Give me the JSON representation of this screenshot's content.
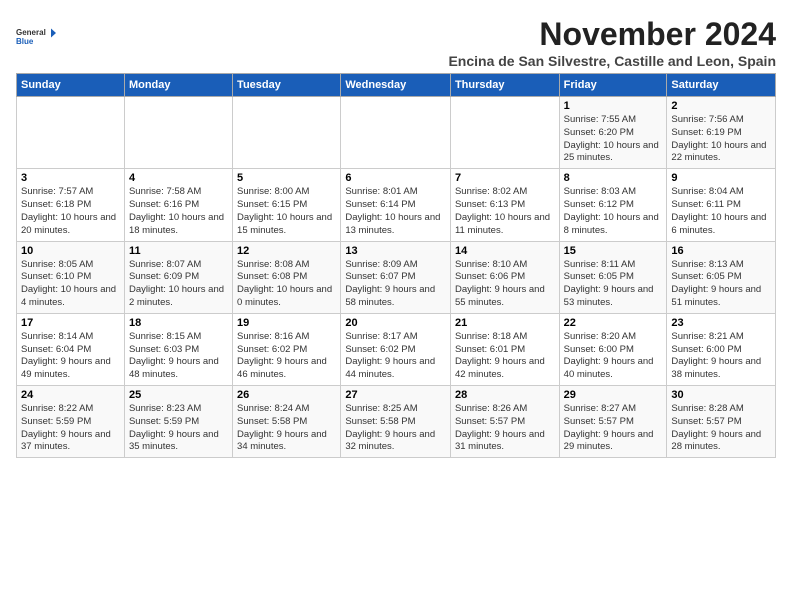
{
  "logo": {
    "line1": "General",
    "line2": "Blue"
  },
  "title": "November 2024",
  "subtitle": "Encina de San Silvestre, Castille and Leon, Spain",
  "days_of_week": [
    "Sunday",
    "Monday",
    "Tuesday",
    "Wednesday",
    "Thursday",
    "Friday",
    "Saturday"
  ],
  "weeks": [
    [
      {
        "day": "",
        "info": ""
      },
      {
        "day": "",
        "info": ""
      },
      {
        "day": "",
        "info": ""
      },
      {
        "day": "",
        "info": ""
      },
      {
        "day": "",
        "info": ""
      },
      {
        "day": "1",
        "info": "Sunrise: 7:55 AM\nSunset: 6:20 PM\nDaylight: 10 hours and 25 minutes."
      },
      {
        "day": "2",
        "info": "Sunrise: 7:56 AM\nSunset: 6:19 PM\nDaylight: 10 hours and 22 minutes."
      }
    ],
    [
      {
        "day": "3",
        "info": "Sunrise: 7:57 AM\nSunset: 6:18 PM\nDaylight: 10 hours and 20 minutes."
      },
      {
        "day": "4",
        "info": "Sunrise: 7:58 AM\nSunset: 6:16 PM\nDaylight: 10 hours and 18 minutes."
      },
      {
        "day": "5",
        "info": "Sunrise: 8:00 AM\nSunset: 6:15 PM\nDaylight: 10 hours and 15 minutes."
      },
      {
        "day": "6",
        "info": "Sunrise: 8:01 AM\nSunset: 6:14 PM\nDaylight: 10 hours and 13 minutes."
      },
      {
        "day": "7",
        "info": "Sunrise: 8:02 AM\nSunset: 6:13 PM\nDaylight: 10 hours and 11 minutes."
      },
      {
        "day": "8",
        "info": "Sunrise: 8:03 AM\nSunset: 6:12 PM\nDaylight: 10 hours and 8 minutes."
      },
      {
        "day": "9",
        "info": "Sunrise: 8:04 AM\nSunset: 6:11 PM\nDaylight: 10 hours and 6 minutes."
      }
    ],
    [
      {
        "day": "10",
        "info": "Sunrise: 8:05 AM\nSunset: 6:10 PM\nDaylight: 10 hours and 4 minutes."
      },
      {
        "day": "11",
        "info": "Sunrise: 8:07 AM\nSunset: 6:09 PM\nDaylight: 10 hours and 2 minutes."
      },
      {
        "day": "12",
        "info": "Sunrise: 8:08 AM\nSunset: 6:08 PM\nDaylight: 10 hours and 0 minutes."
      },
      {
        "day": "13",
        "info": "Sunrise: 8:09 AM\nSunset: 6:07 PM\nDaylight: 9 hours and 58 minutes."
      },
      {
        "day": "14",
        "info": "Sunrise: 8:10 AM\nSunset: 6:06 PM\nDaylight: 9 hours and 55 minutes."
      },
      {
        "day": "15",
        "info": "Sunrise: 8:11 AM\nSunset: 6:05 PM\nDaylight: 9 hours and 53 minutes."
      },
      {
        "day": "16",
        "info": "Sunrise: 8:13 AM\nSunset: 6:05 PM\nDaylight: 9 hours and 51 minutes."
      }
    ],
    [
      {
        "day": "17",
        "info": "Sunrise: 8:14 AM\nSunset: 6:04 PM\nDaylight: 9 hours and 49 minutes."
      },
      {
        "day": "18",
        "info": "Sunrise: 8:15 AM\nSunset: 6:03 PM\nDaylight: 9 hours and 48 minutes."
      },
      {
        "day": "19",
        "info": "Sunrise: 8:16 AM\nSunset: 6:02 PM\nDaylight: 9 hours and 46 minutes."
      },
      {
        "day": "20",
        "info": "Sunrise: 8:17 AM\nSunset: 6:02 PM\nDaylight: 9 hours and 44 minutes."
      },
      {
        "day": "21",
        "info": "Sunrise: 8:18 AM\nSunset: 6:01 PM\nDaylight: 9 hours and 42 minutes."
      },
      {
        "day": "22",
        "info": "Sunrise: 8:20 AM\nSunset: 6:00 PM\nDaylight: 9 hours and 40 minutes."
      },
      {
        "day": "23",
        "info": "Sunrise: 8:21 AM\nSunset: 6:00 PM\nDaylight: 9 hours and 38 minutes."
      }
    ],
    [
      {
        "day": "24",
        "info": "Sunrise: 8:22 AM\nSunset: 5:59 PM\nDaylight: 9 hours and 37 minutes."
      },
      {
        "day": "25",
        "info": "Sunrise: 8:23 AM\nSunset: 5:59 PM\nDaylight: 9 hours and 35 minutes."
      },
      {
        "day": "26",
        "info": "Sunrise: 8:24 AM\nSunset: 5:58 PM\nDaylight: 9 hours and 34 minutes."
      },
      {
        "day": "27",
        "info": "Sunrise: 8:25 AM\nSunset: 5:58 PM\nDaylight: 9 hours and 32 minutes."
      },
      {
        "day": "28",
        "info": "Sunrise: 8:26 AM\nSunset: 5:57 PM\nDaylight: 9 hours and 31 minutes."
      },
      {
        "day": "29",
        "info": "Sunrise: 8:27 AM\nSunset: 5:57 PM\nDaylight: 9 hours and 29 minutes."
      },
      {
        "day": "30",
        "info": "Sunrise: 8:28 AM\nSunset: 5:57 PM\nDaylight: 9 hours and 28 minutes."
      }
    ]
  ]
}
